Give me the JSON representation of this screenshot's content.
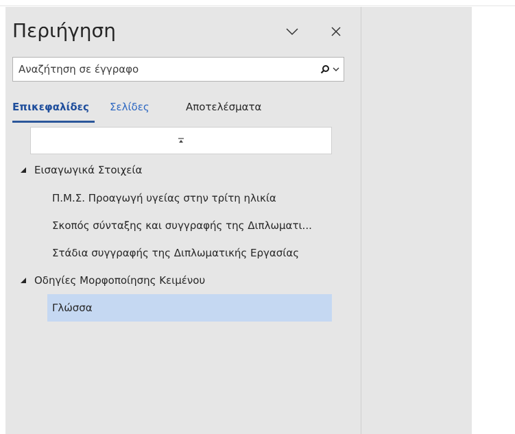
{
  "nav": {
    "title": "Περιήγηση",
    "search": {
      "placeholder": "Αναζήτηση σε έγγραφο",
      "value": ""
    },
    "tabs": [
      {
        "label": "Επικεφαλίδες",
        "active": true
      },
      {
        "label": "Σελίδες",
        "active": false
      },
      {
        "label": "Αποτελέσματα",
        "active": false
      }
    ],
    "tree": [
      {
        "label": "Εισαγωγικά Στοιχεία",
        "level": 1,
        "expanded": true
      },
      {
        "label": "Π.Μ.Σ. Προαγωγή υγείας στην τρίτη ηλικία",
        "level": 2
      },
      {
        "label": "Σκοπός σύνταξης και συγγραφής της Διπλωματι...",
        "level": 2
      },
      {
        "label": "Στάδια συγγραφής της Διπλωματικής Εργασίας",
        "level": 2
      },
      {
        "label": "Οδηγίες Μορφοποίησης Κειμένου",
        "level": 1,
        "expanded": true
      },
      {
        "label": "Γλώσσα",
        "level": 2,
        "selected": true
      }
    ]
  },
  "icons": {
    "collapse_all": "collapse-up-icon",
    "dropdown": "chevron-down-icon",
    "close": "close-icon",
    "search": "search-icon"
  },
  "colors": {
    "accent": "#2b579a",
    "link": "#2b66c1",
    "selected_bg": "#c5d8f2",
    "pane_bg": "#e6e6e6"
  }
}
